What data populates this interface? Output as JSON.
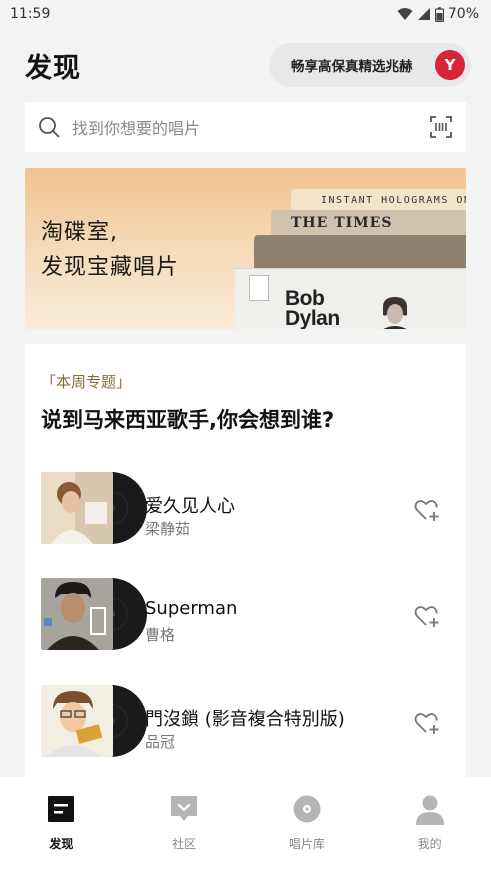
{
  "status_bar": {
    "time": "11:59",
    "battery": "70%"
  },
  "header": {
    "title": "发现",
    "promo_text": "畅享高保真精选兆赫",
    "promo_logo": "Y"
  },
  "search": {
    "placeholder": "找到你想要的唱片"
  },
  "banner": {
    "line1": "淘碟室,",
    "line2": "发现宝藏唱片",
    "book1_text": "INSTANT HOLOGRAMS ON A",
    "book2_text": "THE TIMES",
    "album_text1": "Bob",
    "album_text2": "Dylan"
  },
  "topic": {
    "tag": "「本周专题」",
    "title": "说到马来西亚歌手,你会想到谁?"
  },
  "tracks": [
    {
      "title": "爱久见人心",
      "artist": "梁静茹"
    },
    {
      "title": "Superman",
      "artist": "曹格"
    },
    {
      "title": "門沒鎖 (影音複合特別版)",
      "artist": "品冠"
    }
  ],
  "tabbar": {
    "tabs": [
      {
        "label": "发现",
        "icon": "discover-icon",
        "active": true
      },
      {
        "label": "社区",
        "icon": "community-icon",
        "active": false
      },
      {
        "label": "唱片库",
        "icon": "record-library-icon",
        "active": false
      },
      {
        "label": "我的",
        "icon": "profile-icon",
        "active": false
      }
    ]
  },
  "colors": {
    "accent_tag": "#8a6a3a",
    "promo_logo": "#d8243a",
    "banner_gradient_top": "#f0c48e"
  }
}
